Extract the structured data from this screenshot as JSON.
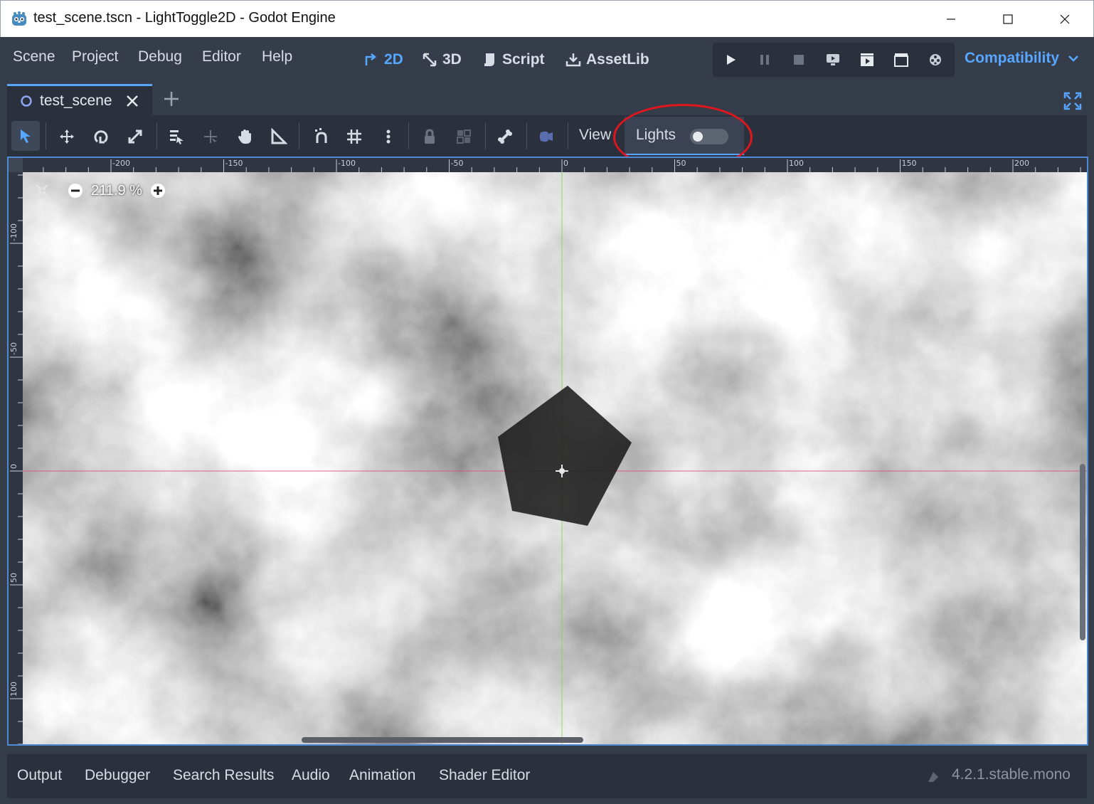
{
  "window": {
    "title": "test_scene.tscn - LightToggle2D - Godot Engine",
    "icon": "godot-icon"
  },
  "menu": {
    "items": [
      "Scene",
      "Project",
      "Debug",
      "Editor",
      "Help"
    ]
  },
  "workspaces": {
    "items": [
      {
        "label": "2D",
        "icon": "2d-icon",
        "active": true
      },
      {
        "label": "3D",
        "icon": "3d-icon",
        "active": false
      },
      {
        "label": "Script",
        "icon": "script-icon",
        "active": false
      },
      {
        "label": "AssetLib",
        "icon": "assetlib-icon",
        "active": false
      }
    ]
  },
  "run_controls": [
    "play-icon",
    "pause-icon",
    "stop-icon",
    "remote-debug-icon",
    "play-scene-icon",
    "play-custom-icon",
    "movie-maker-icon"
  ],
  "renderer": "Compatibility",
  "scene_tabs": {
    "active": "test_scene"
  },
  "toolbar": {
    "view_label": "View",
    "lights_label": "Lights",
    "lights_enabled": false
  },
  "viewport": {
    "zoom": "211.9 %",
    "ruler_x_labels": [
      "-200",
      "-150",
      "-100",
      "-50",
      "0",
      "50",
      "100",
      "150",
      "200"
    ],
    "ruler_y_labels": [
      "-100",
      "-50",
      "0",
      "50",
      "100"
    ]
  },
  "bottom_tabs": [
    "Output",
    "Debugger",
    "Search Results",
    "Audio",
    "Animation",
    "Shader Editor"
  ],
  "version": "4.2.1.stable.mono",
  "colors": {
    "accent": "#57a6ff",
    "annotation": "#e0161e",
    "x_axis": "#e04a7a",
    "y_axis": "#8bd04b"
  }
}
